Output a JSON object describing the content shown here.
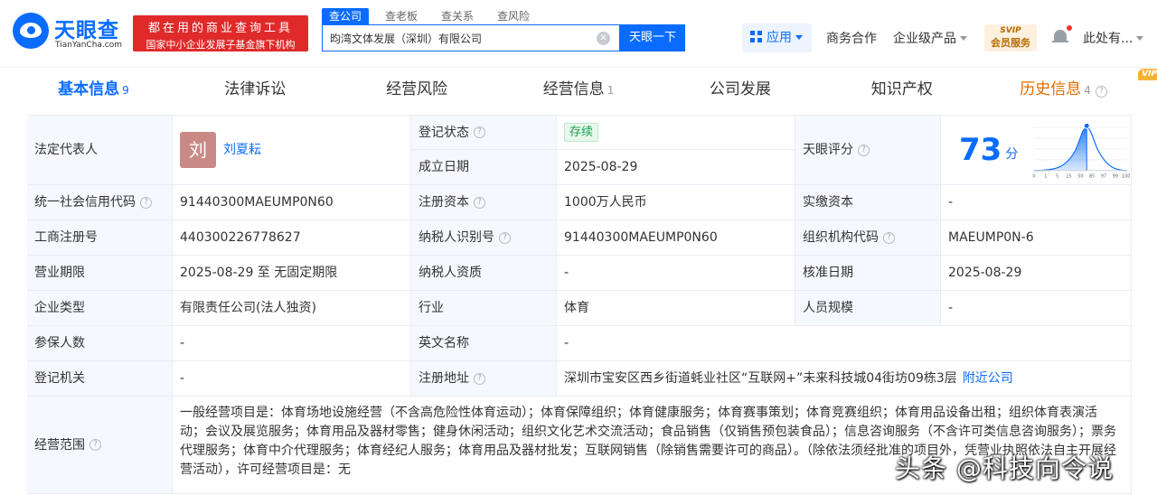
{
  "brand": {
    "name": "天眼查",
    "domain": "TianYanCha.com",
    "slogan_line1": "都在用的商业查询工具",
    "slogan_line2": "国家中小企业发展子基金旗下机构",
    "primary_color": "#0a6cff",
    "slogan_bg": "#e02a2a"
  },
  "search": {
    "tabs": [
      "查公司",
      "查老板",
      "查关系",
      "查风险"
    ],
    "active_tab": "查公司",
    "value": "昀湾文体发展（深圳）有限公司",
    "button": "天眼一下"
  },
  "header": {
    "apps": "应用",
    "partner": "商务合作",
    "enterprise": "企业级产品",
    "svip_top": "SVIP",
    "svip_bottom": "会员服务",
    "user": "此处有..."
  },
  "company_tabs": [
    {
      "label": "基本信息",
      "count": "9",
      "active": true
    },
    {
      "label": "法律诉讼",
      "count": ""
    },
    {
      "label": "经营风险",
      "count": ""
    },
    {
      "label": "经营信息",
      "count": "1"
    },
    {
      "label": "公司发展",
      "count": ""
    },
    {
      "label": "知识产权",
      "count": ""
    },
    {
      "label": "历史信息",
      "count": "4",
      "vip": "VIP"
    }
  ],
  "info": {
    "legal_rep_label": "法定代表人",
    "legal_rep_avatar": "刘",
    "legal_rep_name": "刘夏耘",
    "reg_status_label": "登记状态",
    "reg_status": "存续",
    "founded_label": "成立日期",
    "founded": "2025-08-29",
    "score_label": "天眼评分",
    "score": "73",
    "score_unit": "分",
    "score_axis": [
      "0",
      "1",
      "5",
      "15",
      "50",
      "85",
      "97",
      "99",
      "100"
    ],
    "credit_code_label": "统一社会信用代码",
    "credit_code": "91440300MAEUMP0N60",
    "reg_capital_label": "注册资本",
    "reg_capital": "1000万人民币",
    "paid_capital_label": "实缴资本",
    "paid_capital": "-",
    "biz_reg_no_label": "工商注册号",
    "biz_reg_no": "440300226778627",
    "taxpayer_id_label": "纳税人识别号",
    "taxpayer_id": "91440300MAEUMP0N60",
    "org_code_label": "组织机构代码",
    "org_code": "MAEUMP0N-6",
    "term_label": "营业期限",
    "term": "2025-08-29 至 无固定期限",
    "taxpayer_qual_label": "纳税人资质",
    "taxpayer_qual": "-",
    "approval_date_label": "核准日期",
    "approval_date": "2025-08-29",
    "company_type_label": "企业类型",
    "company_type": "有限责任公司(法人独资)",
    "industry_label": "行业",
    "industry": "体育",
    "staff_size_label": "人员规模",
    "staff_size": "-",
    "insured_label": "参保人数",
    "insured": "-",
    "english_name_label": "英文名称",
    "english_name": "-",
    "reg_authority_label": "登记机关",
    "reg_authority": "-",
    "address_label": "注册地址",
    "address": "深圳市宝安区西乡街道蚝业社区“互联网+”未来科技城04街坊09栋3层",
    "nearby_link": "附近公司",
    "scope_label": "经营范围",
    "scope": "一般经营项目是：体育场地设施经营（不含高危险性体育运动）；体育保障组织；体育健康服务；体育赛事策划；体育竞赛组织；体育用品设备出租；组织体育表演活动；会议及展览服务；体育用品及器材零售；健身休闲活动；组织文化艺术交流活动；食品销售（仅销售预包装食品）；信息咨询服务（不含许可类信息咨询服务）；票务代理服务；体育中介代理服务；体育经纪人服务；体育用品及器材批发；互联网销售（除销售需要许可的商品）。（除依法须经批准的项目外，凭营业执照依法自主开展经营活动），许可经营项目是：无"
  },
  "watermark": "头条 @科技向令说"
}
